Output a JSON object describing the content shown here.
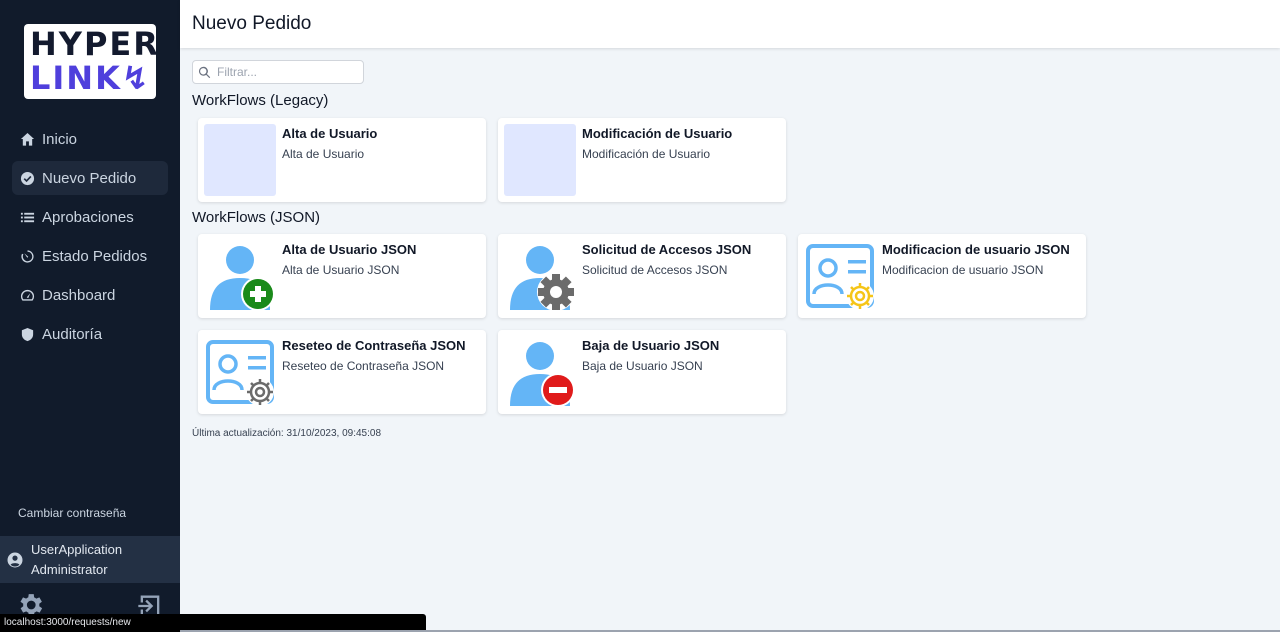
{
  "logo": {
    "line1": "HYPER",
    "line2": "LINK"
  },
  "sidebar": {
    "items": [
      {
        "label": "Inicio",
        "icon": "home-icon"
      },
      {
        "label": "Nuevo Pedido",
        "icon": "check-circle-icon",
        "active": true
      },
      {
        "label": "Aprobaciones",
        "icon": "list-icon"
      },
      {
        "label": "Estado Pedidos",
        "icon": "timer-icon"
      },
      {
        "label": "Dashboard",
        "icon": "gauge-icon"
      },
      {
        "label": "Auditoría",
        "icon": "shield-icon"
      }
    ],
    "change_password": "Cambiar contraseña",
    "user": {
      "line1": "UserApplication",
      "line2": "Administrator"
    }
  },
  "header": {
    "title": "Nuevo Pedido"
  },
  "search": {
    "placeholder": "Filtrar..."
  },
  "sections": {
    "legacy": {
      "title": "WorkFlows (Legacy)"
    },
    "json": {
      "title": "WorkFlows (JSON)"
    }
  },
  "cards": {
    "legacy": [
      {
        "title": "Alta de Usuario",
        "subtitle": "Alta de Usuario"
      },
      {
        "title": "Modificación de Usuario",
        "subtitle": "Modificación de Usuario"
      }
    ],
    "json": [
      {
        "title": "Alta de Usuario JSON",
        "subtitle": "Alta de Usuario JSON",
        "icon": "user-add-icon"
      },
      {
        "title": "Solicitud de Accesos JSON",
        "subtitle": "Solicitud de Accesos JSON",
        "icon": "user-gear-icon"
      },
      {
        "title": "Modificacion de usuario JSON",
        "subtitle": "Modificacion de usuario JSON",
        "icon": "id-card-gear-icon"
      },
      {
        "title": "Reseteo de Contraseña JSON",
        "subtitle": "Reseteo de Contraseña JSON",
        "icon": "id-card-gear-icon"
      },
      {
        "title": "Baja de Usuario JSON",
        "subtitle": "Baja de Usuario JSON",
        "icon": "user-remove-icon"
      }
    ]
  },
  "last_updated": "Última actualización: 31/10/2023, 09:45:08",
  "status_bar": {
    "url": "localhost:3000/requests/new"
  },
  "colors": {
    "sidebar": "#111b2b",
    "accent": "#4f3fdc",
    "user_icon": "#64b5f6",
    "add": "#1a8a1a",
    "remove": "#e01b1b",
    "gear_yellow": "#f5c518"
  }
}
